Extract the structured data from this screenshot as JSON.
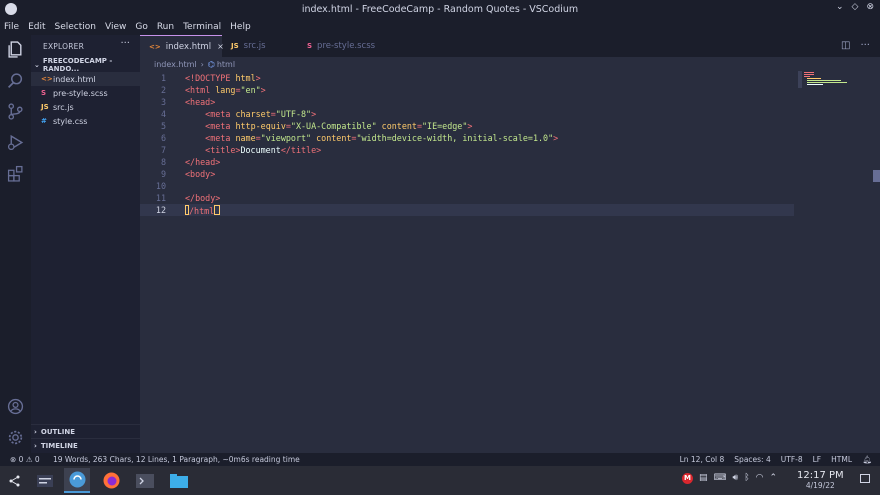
{
  "window": {
    "title": "index.html - FreeCodeCamp - Random Quotes - VSCodium"
  },
  "menu": [
    "File",
    "Edit",
    "Selection",
    "View",
    "Go",
    "Run",
    "Terminal",
    "Help"
  ],
  "sidebar": {
    "header": "EXPLORER",
    "more": "···",
    "folder": "FREECODECAMP - RANDO...",
    "files": [
      {
        "icon": "<>",
        "name": "index.html",
        "color": "#e8883a"
      },
      {
        "icon": "S",
        "name": "pre-style.scss",
        "color": "#f06292"
      },
      {
        "icon": "JS",
        "name": "src.js",
        "color": "#ffcb6b"
      },
      {
        "icon": "#",
        "name": "style.css",
        "color": "#42a5f5"
      }
    ],
    "outline": "OUTLINE",
    "timeline": "TIMELINE"
  },
  "tabs": [
    {
      "icon": "<>",
      "label": "index.html",
      "close": "×"
    },
    {
      "icon": "JS",
      "label": "src.js"
    },
    {
      "icon": "S",
      "label": "pre-style.scss"
    }
  ],
  "breadcrumb": {
    "file": "index.html",
    "node": "html"
  },
  "editor": {
    "line_numbers": [
      "1",
      "2",
      "3",
      "4",
      "5",
      "6",
      "7",
      "8",
      "9",
      "10",
      "11",
      "12"
    ]
  },
  "status": {
    "problems": "⊗ 0 ⚠ 0",
    "message": "19 Words, 263 Chars, 12 Lines, 1 Paragraph, ~0m6s reading time",
    "position": "Ln 12, Col 8",
    "spaces": "Spaces: 4",
    "encoding": "UTF-8",
    "eol": "LF",
    "language": "HTML"
  },
  "clock": {
    "time": "12:17 PM",
    "date": "4/19/22"
  }
}
